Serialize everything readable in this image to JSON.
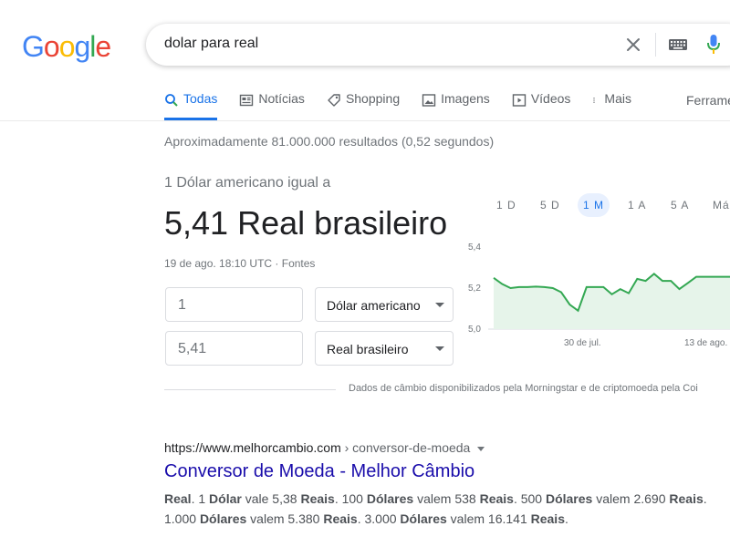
{
  "header": {
    "logo": [
      "G",
      "o",
      "o",
      "g",
      "l",
      "e"
    ],
    "logo_colors": [
      "#4285F4",
      "#EA4335",
      "#FBBC05",
      "#4285F4",
      "#34A853",
      "#EA4335"
    ],
    "search_query": "dolar para real",
    "icons": [
      "clear-icon",
      "keyboard-icon",
      "mic-icon"
    ]
  },
  "tabs": {
    "items": [
      {
        "label": "Todas",
        "icon": "search-icon"
      },
      {
        "label": "Notícias",
        "icon": "news-icon"
      },
      {
        "label": "Shopping",
        "icon": "tag-icon"
      },
      {
        "label": "Imagens",
        "icon": "image-icon"
      },
      {
        "label": "Vídeos",
        "icon": "play-icon"
      },
      {
        "label": "Mais",
        "icon": "more-icon"
      }
    ],
    "active": "Todas",
    "tools_label": "Ferrame"
  },
  "results_stats": "Aproximadamente 81.000.000 resultados (0,52 segundos)",
  "converter": {
    "label": "1 Dólar americano igual a",
    "value": "5,41 Real brasileiro",
    "timestamp": "19 de ago. 18:10 UTC · Fontes",
    "from_amount": "1",
    "from_currency": "Dólar americano",
    "to_amount": "5,41",
    "to_currency": "Real brasileiro",
    "range_tabs": [
      "1 D",
      "5 D",
      "1 M",
      "1 A",
      "5 A",
      "Máx"
    ],
    "active_range": "1 M",
    "source_note": "Dados de câmbio disponibilizados pela Morningstar e de criptomoeda pela Coi"
  },
  "chart_data": {
    "type": "area",
    "y_ticks": [
      "5,4",
      "5,2",
      "5,0"
    ],
    "ylim": [
      5.0,
      5.4
    ],
    "x_labels": [
      "30 de jul.",
      "13 de ago."
    ],
    "values": [
      5.25,
      5.22,
      5.2,
      5.205,
      5.205,
      5.207,
      5.205,
      5.2,
      5.18,
      5.12,
      5.09,
      5.205,
      5.205,
      5.205,
      5.17,
      5.195,
      5.175,
      5.245,
      5.235,
      5.27,
      5.235,
      5.235,
      5.195,
      5.225,
      5.255,
      5.255,
      5.255,
      5.255,
      5.255
    ],
    "color": "#34a853",
    "fill": "#e6f4ea"
  },
  "result": {
    "url_domain": "https://www.melhorcambio.com",
    "url_path": " › conversor-de-moeda",
    "title": "Conversor de Moeda - Melhor Câmbio",
    "snippet": [
      {
        "t": "Real",
        "b": true
      },
      {
        "t": ". 1 ",
        "b": false
      },
      {
        "t": "Dólar",
        "b": true
      },
      {
        "t": " vale 5,38 ",
        "b": false
      },
      {
        "t": "Reais",
        "b": true
      },
      {
        "t": ". 100 ",
        "b": false
      },
      {
        "t": "Dólares",
        "b": true
      },
      {
        "t": " valem 538 ",
        "b": false
      },
      {
        "t": "Reais",
        "b": true
      },
      {
        "t": ". 500 ",
        "b": false
      },
      {
        "t": "Dólares",
        "b": true
      },
      {
        "t": " valem 2.690 ",
        "b": false
      },
      {
        "t": "Reais",
        "b": true
      },
      {
        "t": ". 1.000 ",
        "b": false
      },
      {
        "t": "Dólares",
        "b": true
      },
      {
        "t": " valem 5.380 ",
        "b": false
      },
      {
        "t": "Reais",
        "b": true
      },
      {
        "t": ". 3.000 ",
        "b": false
      },
      {
        "t": "Dólares",
        "b": true
      },
      {
        "t": " valem 16.141 ",
        "b": false
      },
      {
        "t": "Reais",
        "b": true
      },
      {
        "t": ".",
        "b": false
      }
    ]
  }
}
